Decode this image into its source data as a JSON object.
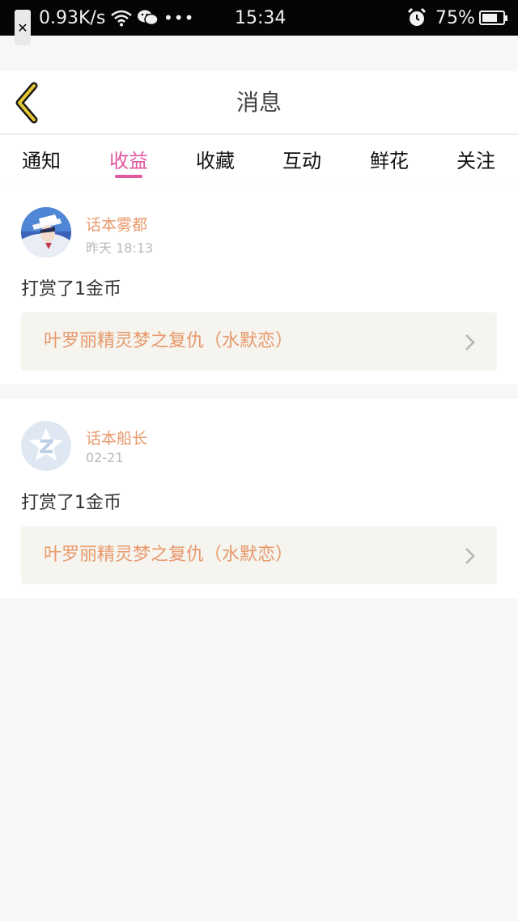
{
  "status_bar": {
    "speed": "0.93K/s",
    "dots": "•••",
    "time": "15:34",
    "battery": "75%",
    "battery_level": 0.75,
    "icons": [
      "close-box-icon",
      "wifi-icon",
      "wechat-icon",
      "alarm-icon",
      "battery-icon"
    ]
  },
  "header": {
    "title": "消息",
    "back_icon": "chevron-left-icon"
  },
  "tabs": [
    {
      "label": "通知",
      "active": false
    },
    {
      "label": "收益",
      "active": true
    },
    {
      "label": "收藏",
      "active": false
    },
    {
      "label": "互动",
      "active": false
    },
    {
      "label": "鲜花",
      "active": false
    },
    {
      "label": "关注",
      "active": false
    }
  ],
  "messages": [
    {
      "user": "话本雾都",
      "time": "昨天 18:13",
      "action": "打赏了1金币",
      "book": "叶罗丽精灵梦之复仇（水默恋）"
    },
    {
      "user": "话本船长",
      "time": "02-21",
      "action": "打赏了1金币",
      "book": "叶罗丽精灵梦之复仇（水默恋）"
    }
  ],
  "colors": {
    "accent": "#e0589e",
    "username": "#e8996b",
    "back_icon": "#e6c832",
    "link_bg": "#f5f4ef"
  }
}
